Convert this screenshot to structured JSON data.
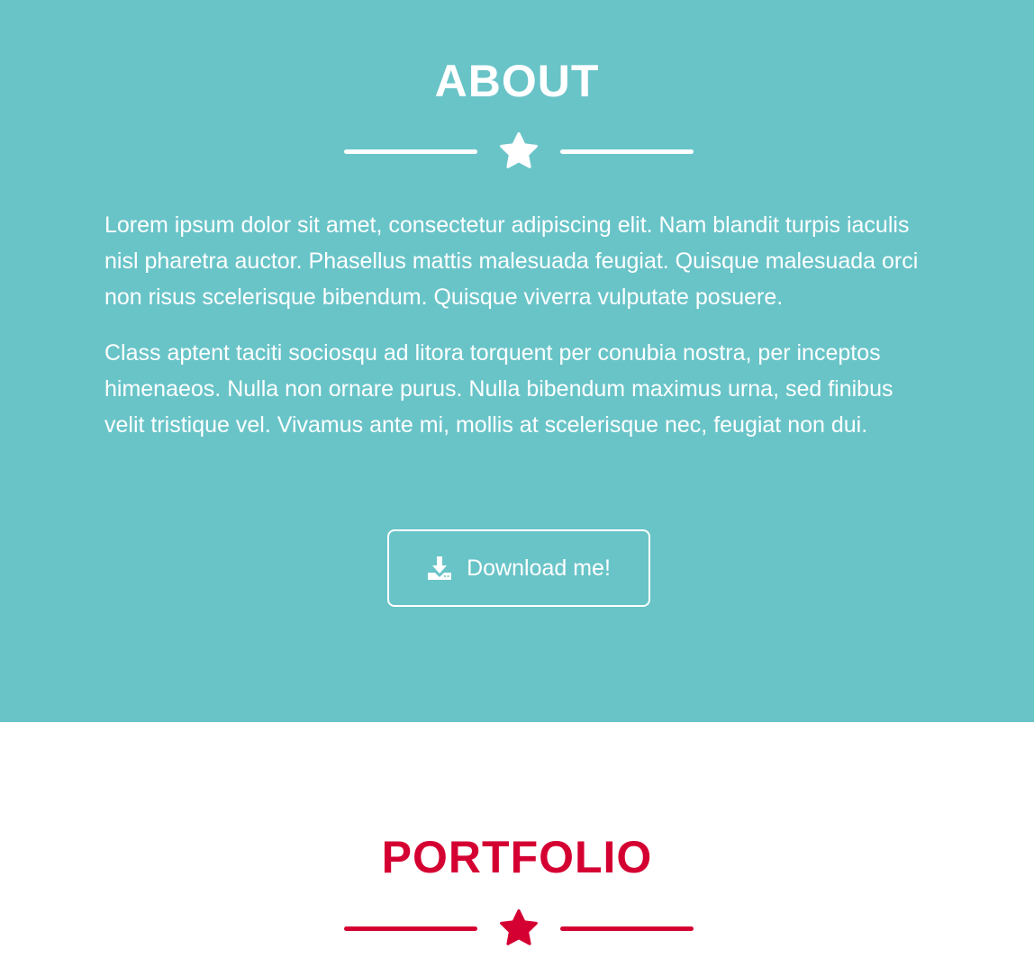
{
  "about": {
    "title": "ABOUT",
    "paragraphs": [
      "Lorem ipsum dolor sit amet, consectetur adipiscing elit. Nam blandit turpis iaculis nisl pharetra auctor. Phasellus mattis malesuada feugiat. Quisque malesuada orci non risus scelerisque bibendum. Quisque viverra vulputate posuere.",
      "Class aptent taciti sociosqu ad litora torquent per conubia nostra, per inceptos himenaeos. Nulla non ornare purus. Nulla bibendum maximus urna, sed finibus velit tristique vel. Vivamus ante mi, mollis at scelerisque nec, feugiat non dui."
    ],
    "download_button": {
      "label": "Download me!",
      "icon": "download-icon"
    },
    "divider_icon": "star-icon",
    "colors": {
      "background": "#69C4C8",
      "foreground": "#FFFFFF"
    }
  },
  "portfolio": {
    "title": "PORTFOLIO",
    "divider_icon": "star-icon",
    "colors": {
      "background": "#FFFFFF",
      "accent": "#D50032"
    }
  }
}
